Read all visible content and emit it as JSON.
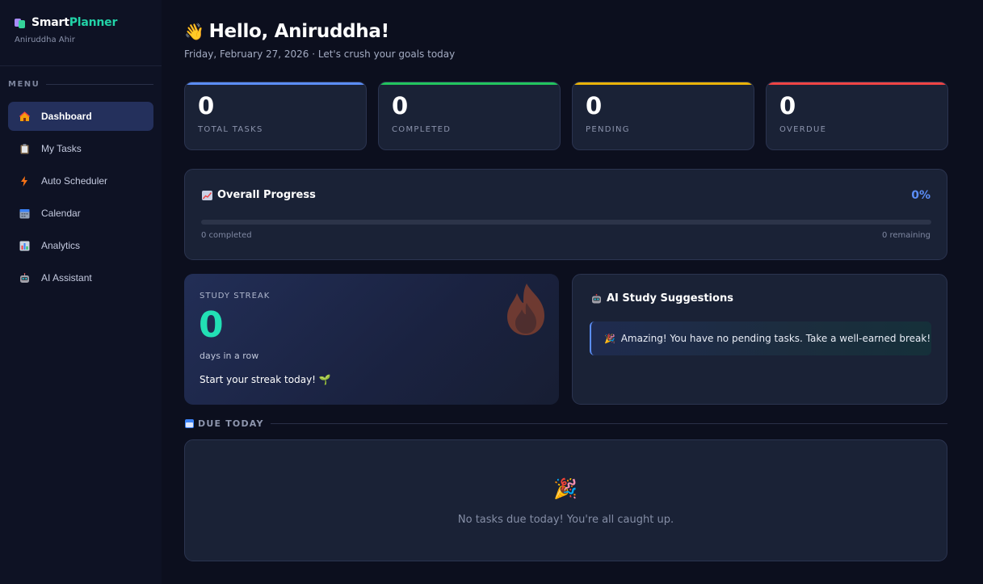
{
  "sidebar": {
    "brand": {
      "part1": "Smart",
      "part2": "Planner"
    },
    "user_name": "Aniruddha Ahir",
    "menu_heading": "MENU",
    "items": [
      {
        "label": "Dashboard",
        "icon": "home-icon",
        "active": true
      },
      {
        "label": "My Tasks",
        "icon": "clipboard-icon",
        "active": false
      },
      {
        "label": "Auto Scheduler",
        "icon": "lightning-icon",
        "active": false
      },
      {
        "label": "Calendar",
        "icon": "calendar-icon",
        "active": false
      },
      {
        "label": "Analytics",
        "icon": "bar-chart-icon",
        "active": false
      },
      {
        "label": "AI Assistant",
        "icon": "robot-icon",
        "active": false
      }
    ]
  },
  "header": {
    "greeting": "Hello, Aniruddha!",
    "greeting_icon": "waving-hand-icon",
    "subtitle": "Friday, February 27, 2026 · Let's crush your goals today"
  },
  "stats": [
    {
      "value": "0",
      "label": "TOTAL TASKS",
      "accent": "#5b8df6"
    },
    {
      "value": "0",
      "label": "COMPLETED",
      "accent": "#22c55e"
    },
    {
      "value": "0",
      "label": "PENDING",
      "accent": "#eab308"
    },
    {
      "value": "0",
      "label": "OVERDUE",
      "accent": "#ef4444"
    }
  ],
  "progress": {
    "title": "Overall Progress",
    "percent_text": "0%",
    "percent": 0,
    "completed_text": "0 completed",
    "remaining_text": "0 remaining"
  },
  "streak": {
    "label": "STUDY STREAK",
    "value": "0",
    "unit": "days in a row",
    "message": "Start your streak today! 🌱"
  },
  "ai": {
    "title": "AI Study Suggestions",
    "tip": "Amazing! You have no pending tasks. Take a well-earned break!"
  },
  "due_today": {
    "heading": "DUE TODAY",
    "empty_message": "No tasks due today! You're all caught up."
  },
  "colors": {
    "accent_blue": "#5b8df6",
    "accent_teal": "#22e0b5",
    "background": "#0c0f1e",
    "card": "#1a2236"
  }
}
